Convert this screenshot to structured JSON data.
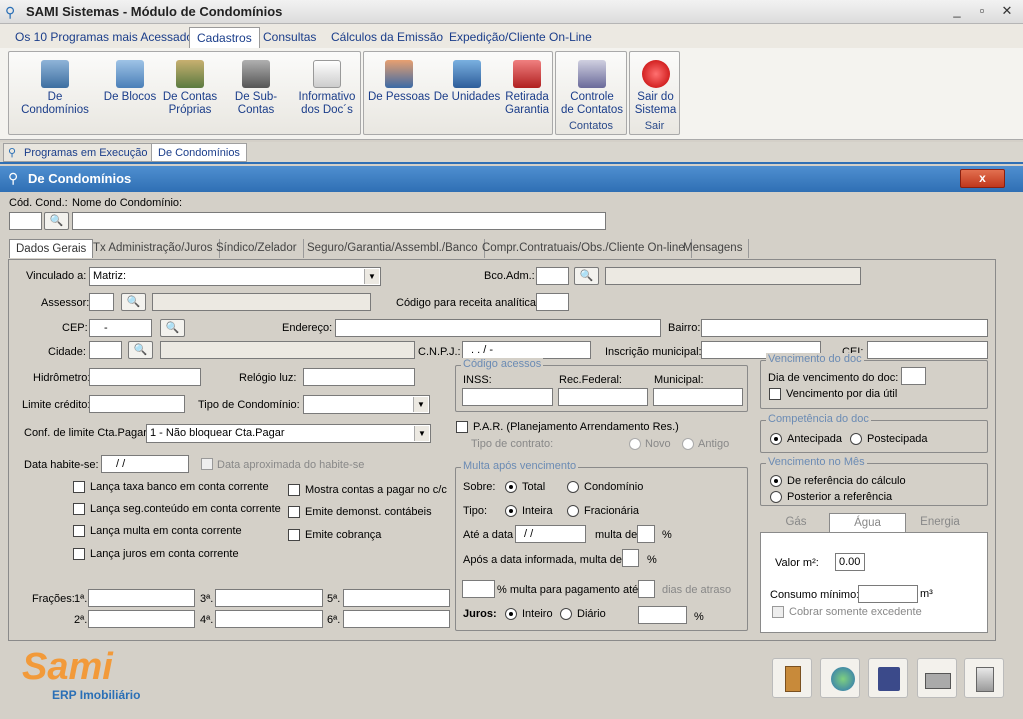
{
  "window": {
    "title": "SAMI Sistemas - Módulo de Condomínios",
    "controls": {
      "minimize": "_",
      "restore": "▫",
      "close": "✕"
    }
  },
  "menu": [
    {
      "label": "Os 10 Programas mais Acessados"
    },
    {
      "label": "Cadastros"
    },
    {
      "label": "Consultas"
    },
    {
      "label": "Cálculos da Emissão"
    },
    {
      "label": "Expedição/Cliente On-Line"
    }
  ],
  "ribbon": {
    "g1": [
      {
        "line1": "De Condomínios",
        "line2": ""
      },
      {
        "line1": "De Blocos",
        "line2": ""
      },
      {
        "line1": "De Contas",
        "line2": "Próprias"
      },
      {
        "line1": "De Sub-Contas",
        "line2": ""
      },
      {
        "line1": "Informativo",
        "line2": "dos Doc´s"
      }
    ],
    "g2": [
      {
        "line1": "De Pessoas",
        "line2": ""
      },
      {
        "line1": "De Unidades",
        "line2": ""
      },
      {
        "line1": "Retirada",
        "line2": "Garantia"
      }
    ],
    "g3": {
      "line1": "Controle",
      "line2": "de Contatos",
      "group": "Contatos"
    },
    "g4": {
      "line1": "Sair do",
      "line2": "Sistema",
      "group": "Sair"
    }
  },
  "ptabs": [
    "Programas em Execução",
    "De Condomínios"
  ],
  "form": {
    "title": "De Condomínios",
    "close": "x",
    "cod_label": "Cód. Cond.:",
    "nome_label": "Nome do Condomínio:",
    "tabs": [
      "Dados Gerais",
      "Tx Administração/Juros",
      "Síndico/Zelador",
      "Seguro/Garantia/Assembl./Banco",
      "Compr.Contratuais/Obs./Cliente On-line",
      "Mensagens"
    ],
    "vinculado_label": "Vinculado a:",
    "vinculado_value": "Matriz:",
    "bco_label": "Bco.Adm.:",
    "assessor_label": "Assessor:",
    "codigo_label": "Código para receita analítica:",
    "cep_label": "CEP:",
    "cep_value": "-",
    "endereco_label": "Endereço:",
    "bairro_label": "Bairro:",
    "cidade_label": "Cidade:",
    "cnpj_label": "C.N.P.J.:",
    "cnpj_value": ". . / -",
    "inscricao_label": "Inscrição municipal:",
    "cei_label": "CEI:",
    "hidrometro_label": "Hidrômetro:",
    "relogio_label": "Relógio luz:",
    "limite_label": "Limite crédito:",
    "tipo_cond_label": "Tipo de Condomínio:",
    "conf_label": "Conf. de limite Cta.Pagar:",
    "conf_value": "1 - Não bloquear Cta.Pagar",
    "habite_label": "Data habite-se:",
    "habite_value": "/ /",
    "data_aprox": "Data aproximada do habite-se",
    "chk_left": [
      "Lança taxa banco em conta corrente",
      "Lança seg.conteúdo em conta corrente",
      "Lança multa em conta corrente",
      "Lança juros em conta corrente"
    ],
    "chk_right": [
      "Mostra contas a pagar no c/c",
      "Emite demonst. contábeis",
      "Emite cobrança"
    ],
    "fracoes_label": "Frações:",
    "fr": [
      "1ª.",
      "2ª.",
      "3ª.",
      "4ª.",
      "5ª.",
      "6ª."
    ],
    "codigo_acessos": "Código acessos",
    "inss": "INSS:",
    "rec_federal": "Rec.Federal:",
    "municipal": "Municipal:",
    "par_label": "P.A.R. (Planejamento Arrendamento Res.)",
    "tipo_contrato": "Tipo de contrato:",
    "novo": "Novo",
    "antigo": "Antigo",
    "multa_leg": "Multa após vencimento",
    "sobre": "Sobre:",
    "total": "Total",
    "condominio": "Condomínio",
    "tipo": "Tipo:",
    "inteira": "Inteira",
    "fracionaria": "Fracionária",
    "ate_data": "Até a data",
    "ate_data_value": "/ /",
    "multa_de": "multa de",
    "pct": "%",
    "apos_data": "Após a data informada, multa de",
    "multa_pgto": "% multa para pagamento até",
    "dias_atraso": "dias de atraso",
    "juros": "Juros:",
    "inteiro": "Inteiro",
    "diario": "Diário",
    "venc_doc": "Vencimento do doc",
    "dia_venc": "Dia de vencimento do doc:",
    "venc_dia_util": "Vencimento por dia útil",
    "competencia": "Competência do doc",
    "antecipada": "Antecipada",
    "postecipada": "Postecipada",
    "venc_mes": "Vencimento no Mês",
    "ref_calculo": "De referência do cálculo",
    "posterior_ref": "Posterior a referência",
    "gtabs": [
      "Gás",
      "Água",
      "Energia"
    ],
    "valor_m2": "Valor m²:",
    "valor_m2_value": "0.00",
    "consumo_min": "Consumo mínimo:",
    "m3": "m³",
    "cobrar_exc": "Cobrar somente excedente"
  },
  "logo": {
    "name": "Sami",
    "sub": "ERP Imobiliário"
  },
  "colors": {
    "accent": "#2f6fb4",
    "logo": "#f29a3a"
  }
}
